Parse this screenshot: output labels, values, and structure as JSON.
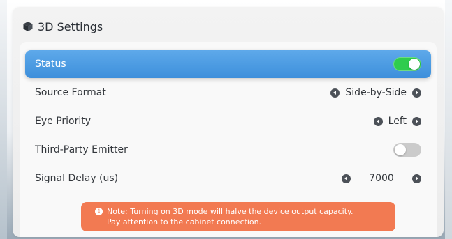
{
  "panel": {
    "title": "3D Settings",
    "title_icon": "cube-icon"
  },
  "settings": {
    "status": {
      "label": "Status",
      "value": true
    },
    "source_format": {
      "label": "Source Format",
      "value": "Side-by-Side"
    },
    "eye_priority": {
      "label": "Eye Priority",
      "value": "Left"
    },
    "third_party_emitter": {
      "label": "Third-Party Emitter",
      "value": false
    },
    "signal_delay": {
      "label": "Signal Delay (us)",
      "value": "7000"
    }
  },
  "note": {
    "line1": "Note: Turning on 3D mode will halve the device output capacity.",
    "line2": "Pay attention to the cabinet connection.",
    "icon": "info-icon"
  },
  "colors": {
    "active_row": "#4a9be3",
    "toggle_on": "#2fcc4e",
    "toggle_off": "#cbcbcb",
    "note_bg": "#f27a52"
  }
}
